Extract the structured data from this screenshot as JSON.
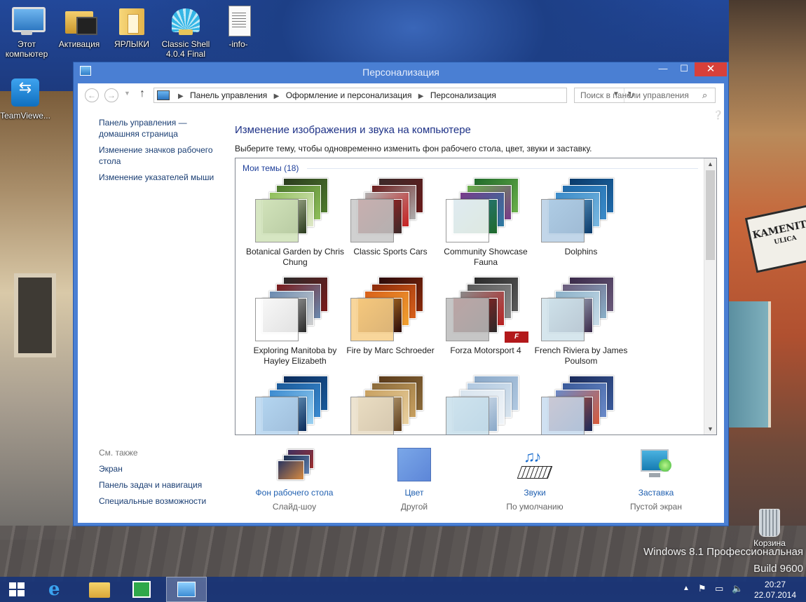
{
  "desktop": {
    "icons": [
      {
        "label": "Этот компьютер",
        "icon": "monitor-icon"
      },
      {
        "label": "Активация",
        "icon": "folder-icon"
      },
      {
        "label": "ЯРЛЫКИ",
        "icon": "folder-icon"
      },
      {
        "label": "Classic Shell 4.0.4 Final",
        "icon": "shell-icon"
      },
      {
        "label": "-info-",
        "icon": "document-icon"
      },
      {
        "label": "TeamViewe...",
        "icon": "teamviewer-icon"
      }
    ],
    "recycle_bin": "Корзина",
    "watermark_line1": "Windows 8.1 Профессиональная",
    "watermark_line2": "Build 9600",
    "street_sign": "KAMENITA",
    "street_sign_sub": "ULICA"
  },
  "window": {
    "title": "Персонализация",
    "controls": {
      "minimize": "—",
      "maximize": "☐",
      "close": "✕"
    }
  },
  "address_bar": {
    "crumbs": [
      "Панель управления",
      "Оформление и персонализация",
      "Персонализация"
    ],
    "search_placeholder": "Поиск в панели управления"
  },
  "left_pane": {
    "links": [
      "Панель управления — домашняя страница",
      "Изменение значков рабочего стола",
      "Изменение указателей мыши"
    ],
    "see_also_title": "См. также",
    "see_also": [
      "Экран",
      "Панель задач и навигация",
      "Специальные возможности"
    ]
  },
  "main": {
    "title": "Изменение изображения и звука на компьютере",
    "description": "Выберите тему, чтобы одновременно изменить фон рабочего стола, цвет, звуки и заставку.",
    "group_title": "Мои темы (18)",
    "themes": [
      {
        "name": "Botanical Garden by Chris Chung",
        "colors": [
          "#2b3b1e",
          "#4d7a2c",
          "#8fbf5a",
          "#dfe8c8"
        ],
        "front": "#cfe2b8"
      },
      {
        "name": "Classic Sports Cars",
        "colors": [
          "#3a2a2a",
          "#6a1a1a",
          "#b0b0b0",
          "#c82020"
        ],
        "front": "#c8c8c8"
      },
      {
        "name": "Community Showcase Fauna",
        "colors": [
          "#1f6a2a",
          "#6ab04a",
          "#7a3a8a",
          "#2a7aa0"
        ],
        "front": "#ffffff"
      },
      {
        "name": "Dolphins",
        "colors": [
          "#0a3a6a",
          "#1f6aaa",
          "#3a8ac8",
          "#7ab8e0"
        ],
        "front": "#b8d0e6"
      },
      {
        "name": "Exploring Manitoba by Hayley Elizabeth",
        "colors": [
          "#2a2a2a",
          "#7a1a1a",
          "#6a8ab0",
          "#cfcfcf"
        ],
        "front": "#ffffff"
      },
      {
        "name": "Fire by Marc Schroeder",
        "colors": [
          "#2a0a0a",
          "#8a2a0a",
          "#d8601a",
          "#f0a030"
        ],
        "front": "#f7cf8a"
      },
      {
        "name": "Forza Motorsport 4",
        "colors": [
          "#2a2a2a",
          "#5a5a5a",
          "#8a8a8a",
          "#b82020"
        ],
        "front": "#bdbdbd"
      },
      {
        "name": "French Riviera by James Poulsom",
        "colors": [
          "#3a2a4a",
          "#6a5a7a",
          "#8ab0c8",
          "#c8dce8"
        ],
        "front": "#cfe2ea"
      },
      {
        "name": "",
        "colors": [
          "#0a2a5a",
          "#1a5a9a",
          "#3a8ad0",
          "#9ad0f0"
        ],
        "front": "#b8d6f0"
      },
      {
        "name": "",
        "colors": [
          "#5a3a1a",
          "#8a6a3a",
          "#c8a060",
          "#e8d0a0"
        ],
        "front": "#eadfc8"
      },
      {
        "name": "",
        "colors": [
          "#8aa8c8",
          "#b0c8e0",
          "#d8e4ee",
          "#f0f4f8"
        ],
        "front": "#c8e0ec"
      },
      {
        "name": "",
        "colors": [
          "#1a2a5a",
          "#3a5a9a",
          "#6a8ac8",
          "#d85a3a"
        ],
        "front": "#c8dcf0"
      }
    ]
  },
  "bottom_options": [
    {
      "title": "Фон рабочего стола",
      "sub": "Слайд-шоу",
      "icon": "desktop-background-icon"
    },
    {
      "title": "Цвет",
      "sub": "Другой",
      "icon": "color-icon"
    },
    {
      "title": "Звуки",
      "sub": "По умолчанию",
      "icon": "sounds-icon"
    },
    {
      "title": "Заставка",
      "sub": "Пустой экран",
      "icon": "screensaver-icon"
    }
  ],
  "taskbar": {
    "time": "20:27",
    "date": "22.07.2014"
  }
}
